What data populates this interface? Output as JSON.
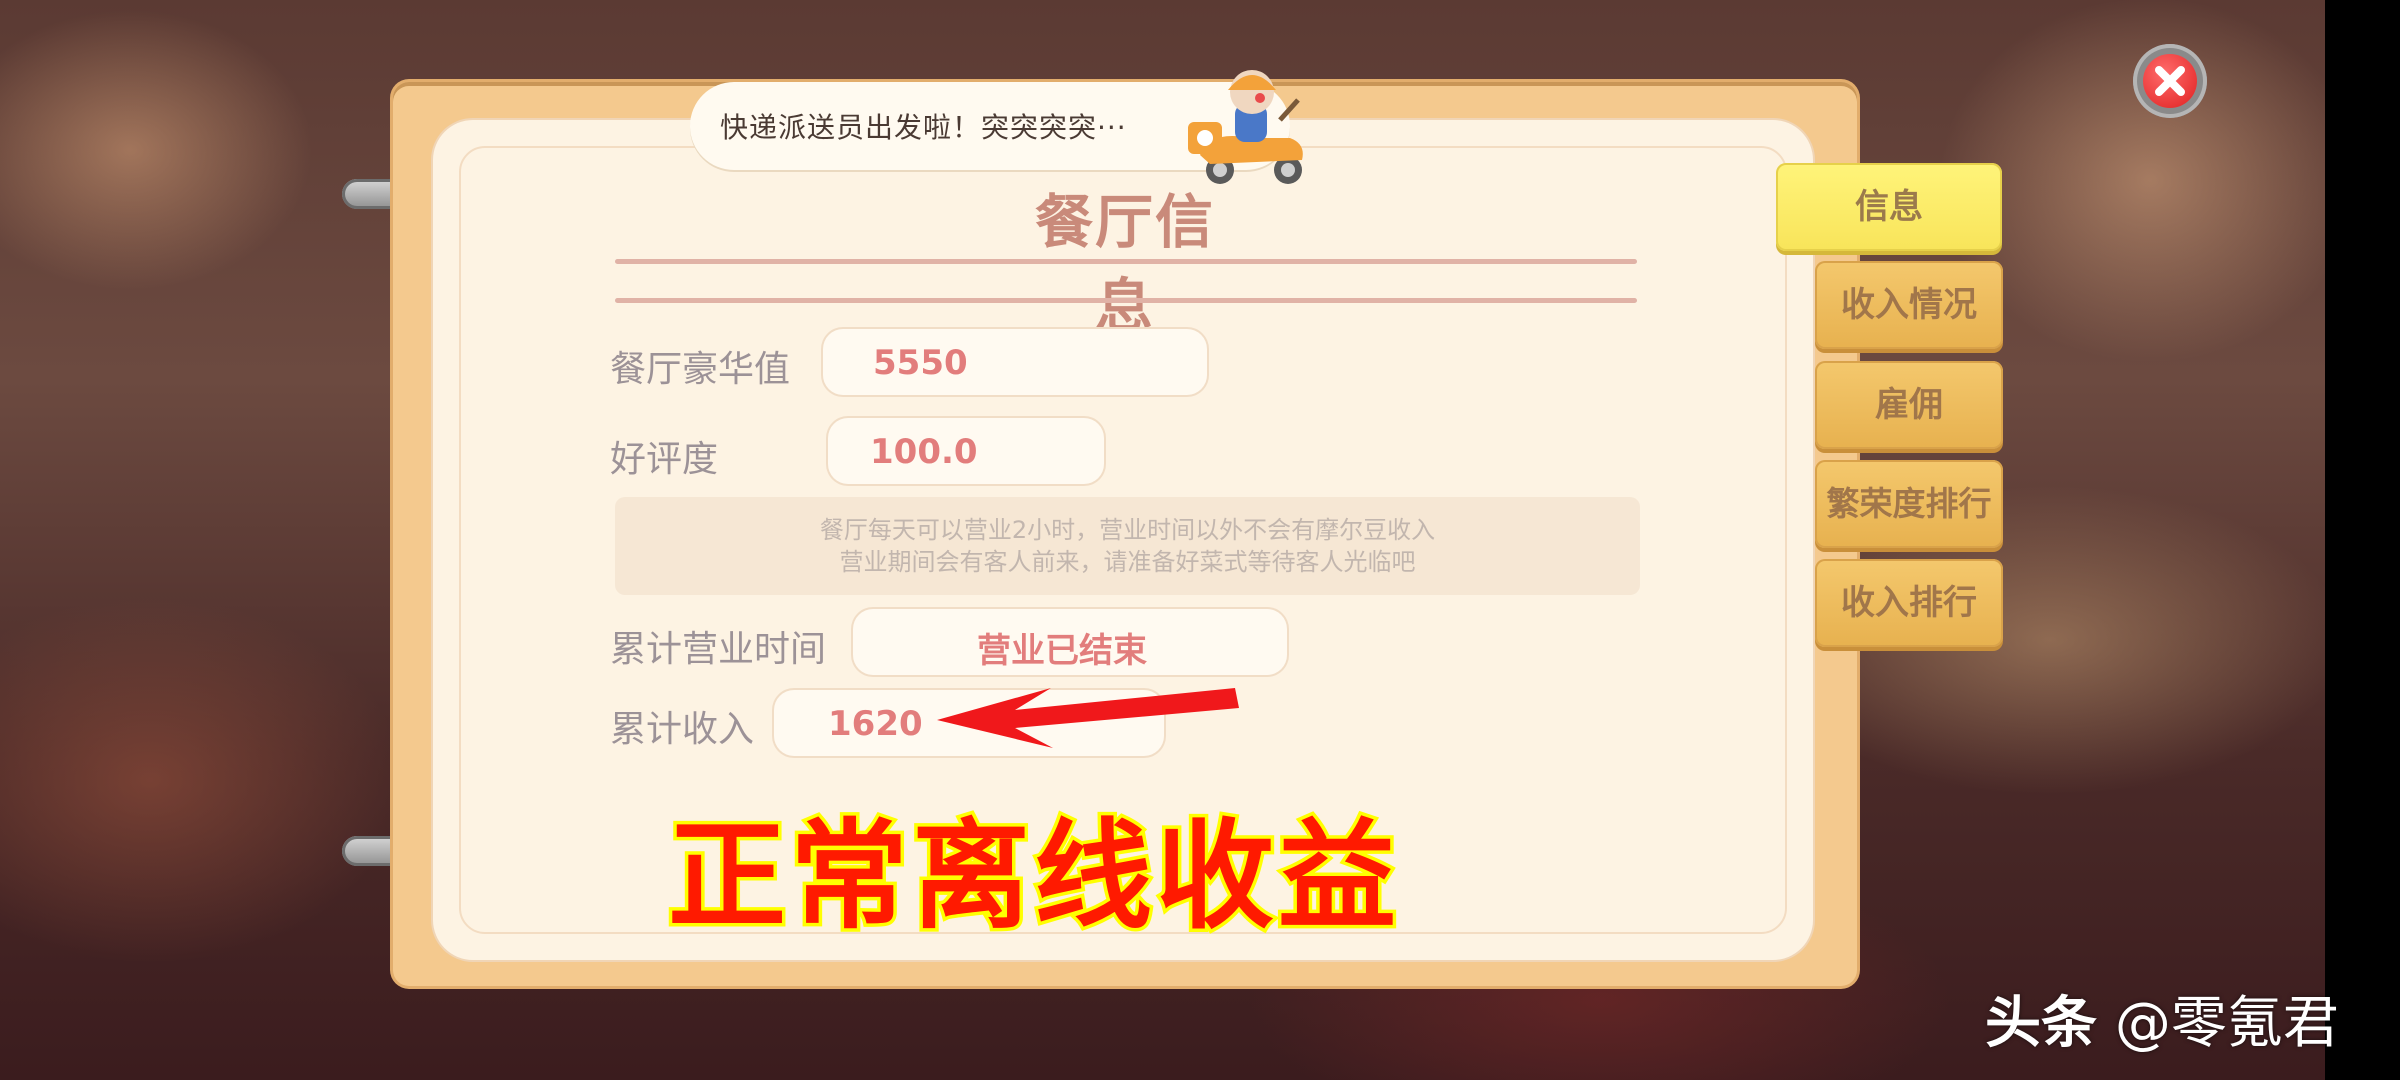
{
  "bubble": {
    "text": "快递派送员出发啦！突突突突···"
  },
  "panel": {
    "title": "餐厅信息"
  },
  "stats": {
    "luxury_label": "餐厅豪华值",
    "luxury_value": "5550",
    "rating_label": "好评度",
    "rating_value": "100.0",
    "notice_line1": "餐厅每天可以营业2小时，营业时间以外不会有摩尔豆收入",
    "notice_line2": "营业期间会有客人前来，请准备好菜式等待客人光临吧",
    "hours_label": "累计营业时间",
    "hours_value": "营业已结束",
    "income_label": "累计收入",
    "income_value": "1620"
  },
  "tabs": [
    {
      "label": "信息",
      "active": true
    },
    {
      "label": "收入情况",
      "active": false
    },
    {
      "label": "雇佣",
      "active": false
    },
    {
      "label": "繁荣度排行",
      "active": false
    },
    {
      "label": "收入排行",
      "active": false
    }
  ],
  "overlay_caption": "正常离线收益",
  "watermark": {
    "brand": "头条",
    "handle": "@零氪君"
  },
  "icons": {
    "close": "close-icon",
    "courier": "courier-scooter-icon",
    "arrow": "red-arrow-icon"
  },
  "colors": {
    "value_text": "#e27d7c",
    "active_tab": "#f8e45a",
    "tab": "#e7b14f",
    "caption": "#ff1a00"
  }
}
